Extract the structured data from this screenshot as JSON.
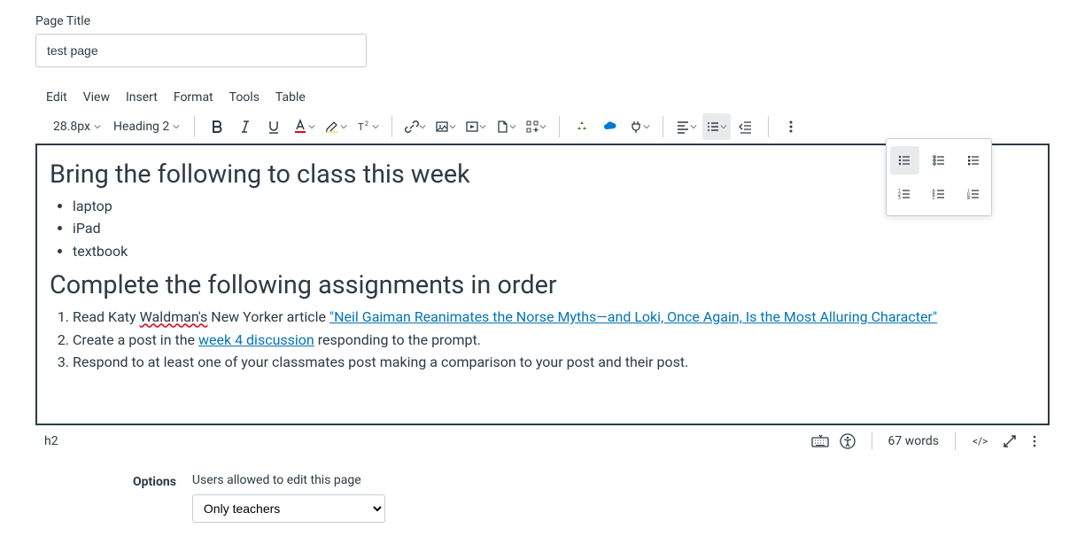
{
  "page_title": {
    "label": "Page Title",
    "value": "test page"
  },
  "menubar": [
    "Edit",
    "View",
    "Insert",
    "Format",
    "Tools",
    "Table"
  ],
  "toolbar": {
    "font_size": "28.8px",
    "block_format": "Heading 2"
  },
  "content": {
    "h2_1": "Bring the following to class this week",
    "ul": [
      "laptop",
      "iPad",
      "textbook"
    ],
    "h2_2": "Complete the following assignments in order",
    "ol": {
      "item1_pre": "Read Katy ",
      "item1_squiggle": "Waldman's",
      "item1_mid": " New Yorker article ",
      "item1_link": "\"Neil Gaiman Reanimates the Norse Myths—and Loki, Once Again, Is the Most Alluring Character\"",
      "item2_pre": "Create a post in the ",
      "item2_link": "week 4 discussion",
      "item2_post": " responding to the prompt.",
      "item3": "Respond to at least one of your classmates post making a comparison to your post and their post."
    }
  },
  "statusbar": {
    "path": "h2",
    "word_count": "67 words"
  },
  "options": {
    "label": "Options",
    "desc": "Users allowed to edit this page",
    "selected": "Only teachers"
  }
}
